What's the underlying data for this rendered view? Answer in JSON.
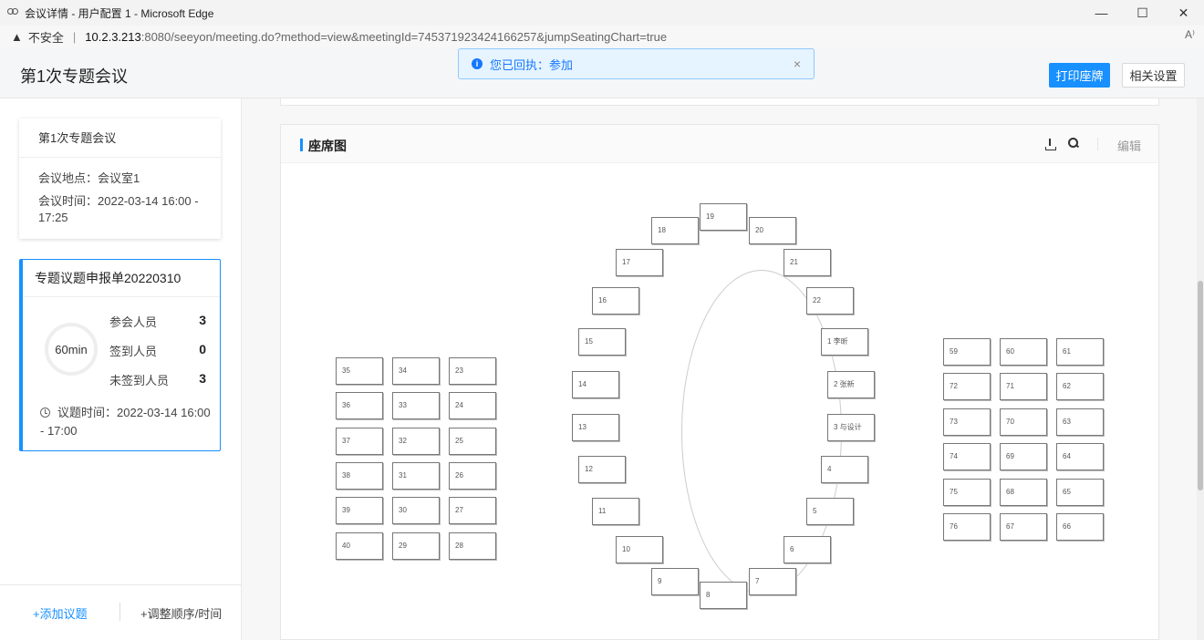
{
  "browser": {
    "window_title": "会议详情 - 用户配置 1 - Microsoft Edge",
    "minimize": "—",
    "maximize": "☐",
    "close": "✕",
    "security_label": "不安全",
    "url_host": "10.2.3.213",
    "url_rest": ":8080/seeyon/meeting.do?method=view&meetingId=745371923424166257&jumpSeatingChart=true",
    "read_aloud": "A⁾"
  },
  "header": {
    "title": "第1次专题会议",
    "print_button": "打印座牌",
    "settings_button": "相关设置"
  },
  "toast": {
    "message": "您已回执：参加",
    "close": "×"
  },
  "sidebar": {
    "meeting_card": {
      "title": "第1次专题会议",
      "location": "会议地点：会议室1",
      "time": "会议时间：2022-03-14 16:00 - 17:25"
    },
    "topic_card": {
      "title": "专题议题申报单20220310",
      "duration": "60min",
      "stats": [
        {
          "label": "参会人员",
          "value": "3"
        },
        {
          "label": "签到人员",
          "value": "0"
        },
        {
          "label": "未签到人员",
          "value": "3"
        }
      ],
      "topic_time": "议题时间：2022-03-14 16:00 - 17:00"
    },
    "footer": {
      "add_topic": "+添加议题",
      "adjust": "+调整顺序/时间"
    }
  },
  "seating": {
    "title": "座席图",
    "edit_label": "编辑",
    "seats": [
      "19",
      "18",
      "20",
      "17",
      "21",
      "16",
      "22",
      "15",
      "1 李昕",
      "14",
      "2 张新",
      "13",
      "3 与设计",
      "12",
      "4",
      "11",
      "5",
      "10",
      "6",
      "9",
      "7",
      "8",
      "35",
      "34",
      "23",
      "36",
      "33",
      "24",
      "37",
      "32",
      "25",
      "38",
      "31",
      "26",
      "39",
      "30",
      "27",
      "40",
      "29",
      "28",
      "59",
      "60",
      "61",
      "72",
      "71",
      "62",
      "73",
      "70",
      "63",
      "74",
      "69",
      "64",
      "75",
      "68",
      "65",
      "76",
      "67",
      "66"
    ]
  }
}
